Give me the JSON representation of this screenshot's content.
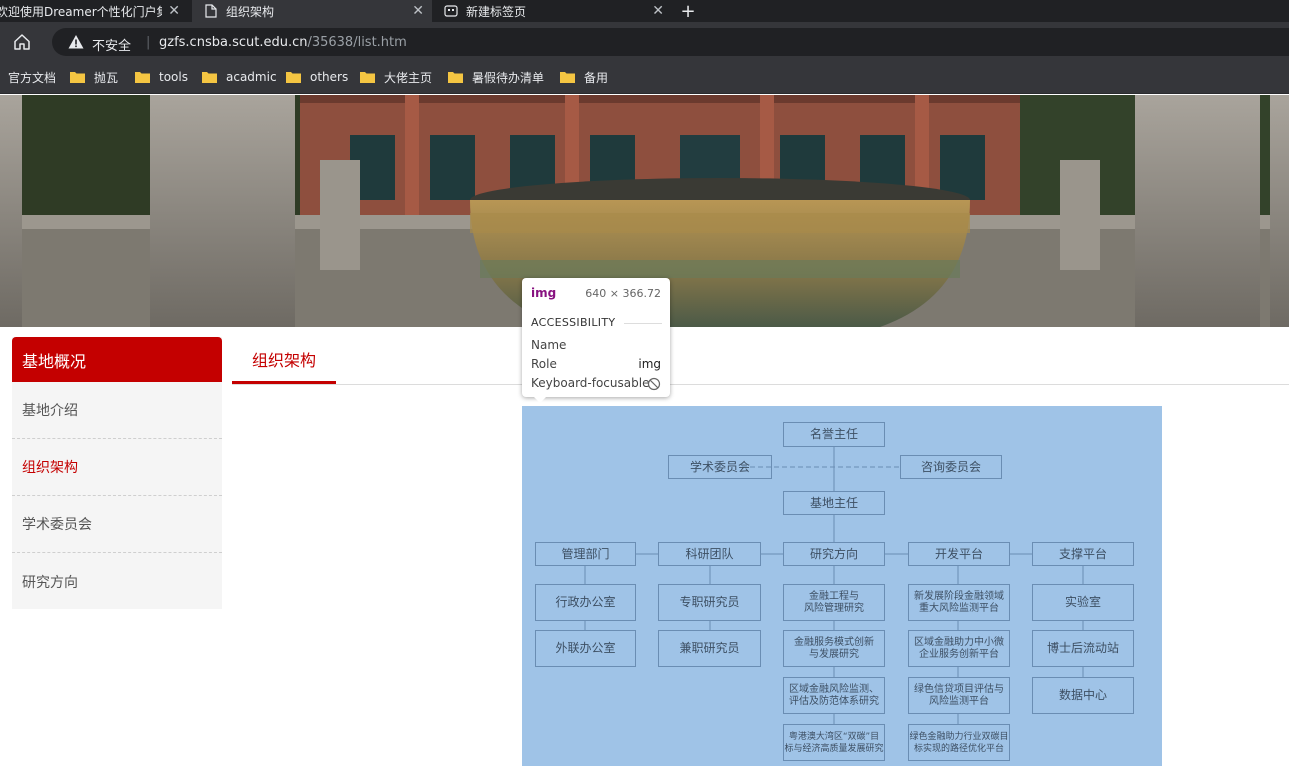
{
  "browser": {
    "tabs": [
      {
        "title": "欢迎使用Dreamer个性化门户集群",
        "close": "✕"
      },
      {
        "title": "组织架构",
        "close": "✕"
      },
      {
        "title": "新建标签页",
        "close": "✕"
      }
    ],
    "new_tab": "+",
    "security_label": "不安全",
    "separator": "|",
    "url_host": "gzfs.cnsba.scut.edu.cn",
    "url_path": "/35638/list.htm",
    "bookmarks": [
      {
        "label": "官方文档"
      },
      {
        "label": "抛瓦"
      },
      {
        "label": "tools"
      },
      {
        "label": "acadmic"
      },
      {
        "label": "others"
      },
      {
        "label": "大佬主页"
      },
      {
        "label": "暑假待办清单"
      },
      {
        "label": "备用"
      }
    ]
  },
  "sidebar": {
    "title": "基地概况",
    "items": [
      {
        "label": "基地介绍"
      },
      {
        "label": "组织架构"
      },
      {
        "label": "学术委员会"
      },
      {
        "label": "研究方向"
      }
    ],
    "active_index": 1
  },
  "content": {
    "tab_label": "组织架构"
  },
  "org_chart": {
    "honorary_director": "名誉主任",
    "academic_committee": "学术委员会",
    "advisory_committee": "咨询委员会",
    "base_director": "基地主任",
    "departments": [
      "管理部门",
      "科研团队",
      "研究方向",
      "开发平台",
      "支撑平台"
    ],
    "management": [
      "行政办公室",
      "外联办公室"
    ],
    "research_team": [
      "专职研究员",
      "兼职研究员"
    ],
    "research_directions": [
      "金融工程与\n风险管理研究",
      "金融服务模式创新\n与发展研究",
      "区域金融风险监测、\n评估及防范体系研究",
      "粤港澳大湾区“双碳”目\n标与经济高质量发展研究"
    ],
    "dev_platforms": [
      "新发展阶段金融领域\n重大风险监测平台",
      "区域金融助力中小微\n企业服务创新平台",
      "绿色信贷项目评估与\n风险监测平台",
      "绿色金融助力行业双碳目\n标实现的路径优化平台"
    ],
    "support": [
      "实验室",
      "博士后流动站",
      "数据中心"
    ]
  },
  "devtools_tooltip": {
    "tag": "img",
    "dimensions": "640 × 366.72",
    "section": "ACCESSIBILITY",
    "rows": [
      {
        "label": "Name",
        "value": ""
      },
      {
        "label": "Role",
        "value": "img"
      },
      {
        "label": "Keyboard-focusable",
        "value": ""
      }
    ]
  },
  "colors": {
    "brand_red": "#c40000",
    "org_bg": "#9fc3e7"
  }
}
